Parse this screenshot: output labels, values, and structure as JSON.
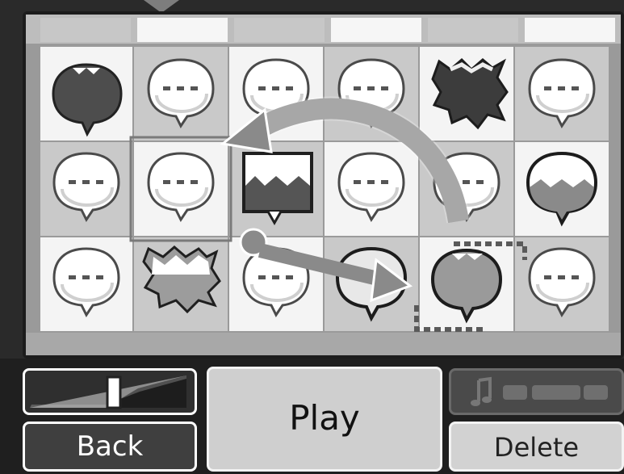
{
  "controls": {
    "play_label": "Play",
    "back_label": "Back",
    "delete_label": "Delete"
  },
  "colors": {
    "light_cell": "#f4f4f4",
    "dark_cell": "#c9c9c9",
    "board_border": "#1c1c1c",
    "arrow": "#8a8a8a"
  },
  "grid": {
    "rows": 3,
    "cols": 6,
    "cells": [
      [
        "filled-round",
        "empty",
        "empty",
        "empty",
        "spiky-dark",
        "empty"
      ],
      [
        "empty",
        "empty-selected",
        "square-wave",
        "empty",
        "empty",
        "round-wave"
      ],
      [
        "empty",
        "spiky-light",
        "empty",
        "round-outline",
        "round-mid",
        "empty"
      ]
    ]
  },
  "icons": {
    "tempo_slider": "slider-icon",
    "music_note": "music-note-icon"
  }
}
